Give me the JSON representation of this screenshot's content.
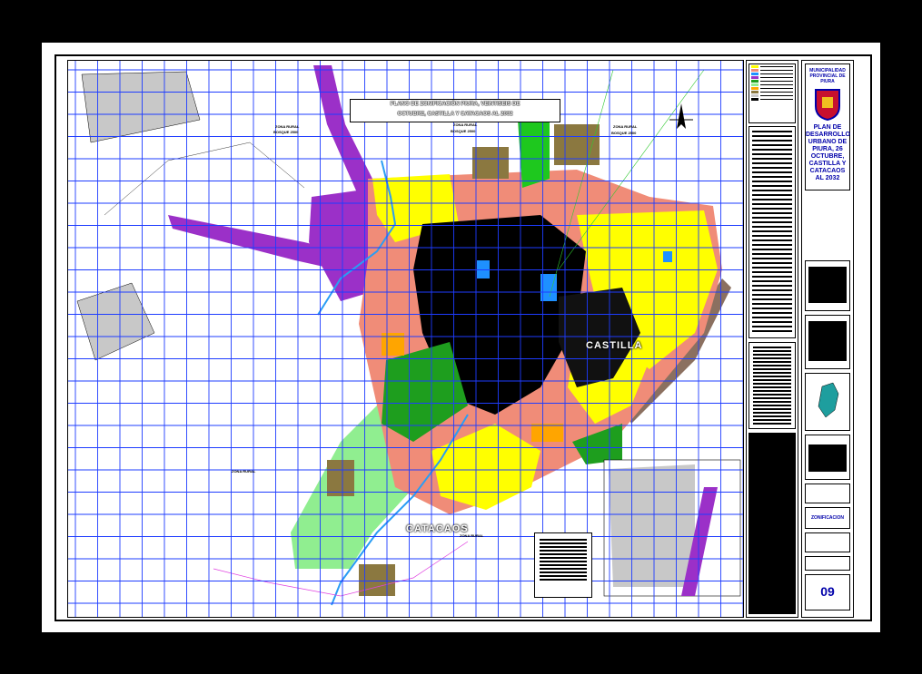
{
  "map": {
    "title_line1": "PLANO DE ZONIFICACIÓN PIURA, VEINTISEIS DE",
    "title_line2": "OCTUBRE, CASTILLA Y CATACAOS AL 2032",
    "labels": {
      "zona_rural_1": "ZONA RURAL",
      "bosque_1": "BOSQUE 2500",
      "zona_rural_2": "ZONA RURAL",
      "bosque_2": "BOSQUE 2500",
      "zona_rural_3": "ZONA RURAL",
      "bosque_3": "BOSQUE 2500",
      "zona_rural_4": "ZONA RURAL",
      "zona_rural_5": "ZONA RURAL",
      "castilla": "CASTILLA",
      "catacaos": "CATACAOS"
    },
    "colors": {
      "grid": "#1e3cff",
      "residential_yellow": "#ffff00",
      "salmon": "#f08c78",
      "purple": "#9b30c8",
      "light_green": "#90ee90",
      "green": "#1e9e1e",
      "olive": "#8b7840",
      "blue_commercial": "#1e90ff",
      "orange": "#ffa500",
      "gray": "#c8c8c8"
    }
  },
  "title_block": {
    "municipality": "MUNICIPALIDAD PROVINCIAL DE PIURA",
    "plan_title": "PLAN DE DESARROLLO URBANO DE PIURA, 26 OCTUBRE, CASTILLA Y CATACAOS AL 2032",
    "sheet_name": "ZONIFICACION",
    "sheet_number": "09"
  }
}
